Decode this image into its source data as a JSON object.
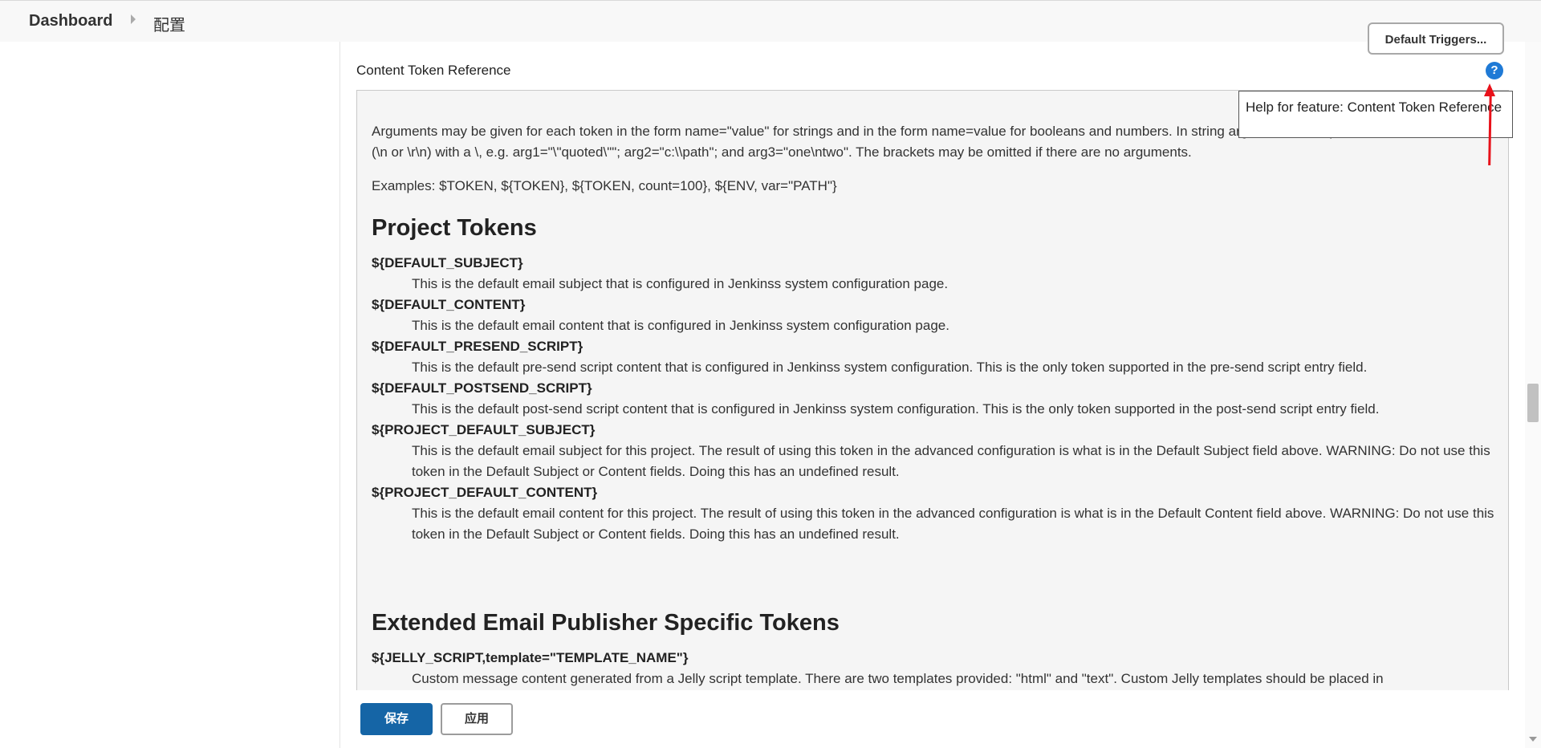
{
  "breadcrumb": {
    "dashboard": "Dashboard",
    "config": "配置"
  },
  "default_triggers_label": "Default Triggers...",
  "section": {
    "title": "Content Token Reference",
    "help_icon": "question-circle-icon",
    "tooltip": "Help for feature: Content Token Reference"
  },
  "help": {
    "intro": "Arguments may be given for each token in the form name=\"value\" for strings and in the form name=value for booleans and numbers. In string arguments, escape \", \\, and line terminators (\\n or \\r\\n) with a \\, e.g. arg1=\"\\\"quoted\\\"\"; arg2=\"c:\\\\path\"; and arg3=\"one\\ntwo\". The brackets may be omitted if there are no arguments.",
    "examples": "Examples: $TOKEN, ${TOKEN}, ${TOKEN, count=100}, ${ENV, var=\"PATH\"}",
    "project_tokens_heading": "Project Tokens",
    "project_tokens": [
      {
        "name": "${DEFAULT_SUBJECT}",
        "desc": "This is the default email subject that is configured in Jenkinss system configuration page."
      },
      {
        "name": "${DEFAULT_CONTENT}",
        "desc": "This is the default email content that is configured in Jenkinss system configuration page."
      },
      {
        "name": "${DEFAULT_PRESEND_SCRIPT}",
        "desc": "This is the default pre-send script content that is configured in Jenkinss system configuration. This is the only token supported in the pre-send script entry field."
      },
      {
        "name": "${DEFAULT_POSTSEND_SCRIPT}",
        "desc": "This is the default post-send script content that is configured in Jenkinss system configuration. This is the only token supported in the post-send script entry field."
      },
      {
        "name": "${PROJECT_DEFAULT_SUBJECT}",
        "desc": "This is the default email subject for this project. The result of using this token in the advanced configuration is what is in the Default Subject field above. WARNING: Do not use this token in the Default Subject or Content fields. Doing this has an undefined result."
      },
      {
        "name": "${PROJECT_DEFAULT_CONTENT}",
        "desc": "This is the default email content for this project. The result of using this token in the advanced configuration is what is in the Default Content field above. WARNING: Do not use this token in the Default Subject or Content fields. Doing this has an undefined result."
      }
    ],
    "extended_heading": "Extended Email Publisher Specific Tokens",
    "extended_tokens": [
      {
        "name": "${JELLY_SCRIPT,template=\"TEMPLATE_NAME\"}",
        "desc": "Custom message content generated from a Jelly script template. There are two templates provided: \"html\" and \"text\". Custom Jelly templates should be placed in <tt>$JENKINS_HOME/email-templates</tt>. When using custom templates, the template filename without \".jelly\" should be used for the \"template\" argument. You may also"
      }
    ]
  },
  "actions": {
    "save": "保存",
    "apply": "应用"
  }
}
